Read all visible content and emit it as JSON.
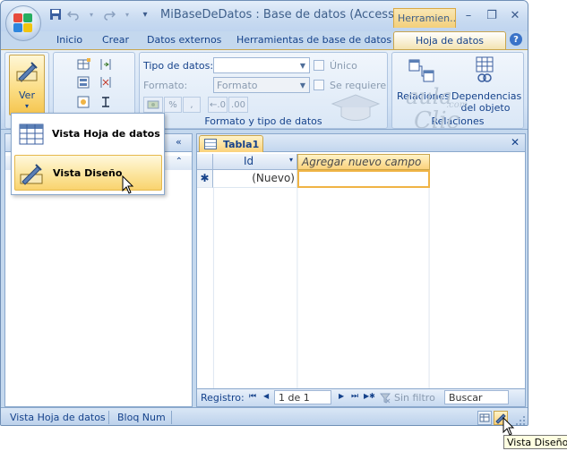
{
  "window": {
    "title": "MiBaseDeDatos : Base de datos (Access...",
    "context_tab": "Herramien...",
    "minimize": "–",
    "restore": "❐",
    "close": "✕"
  },
  "tabs": [
    "Inicio",
    "Crear",
    "Datos externos",
    "Herramientas de base de datos",
    "Hoja de datos"
  ],
  "help": "?",
  "ribbon": {
    "ver_label": "Ver",
    "ver_arrow": "▾",
    "tipo_datos_label": "Tipo de datos:",
    "formato_label": "Formato:",
    "formato_value": "Formato",
    "unico_label": "Único",
    "requiere_label": "Se requiere",
    "fmt_buttons": [
      "%",
      ",",
      "←.0",
      ".00"
    ],
    "group_formato": "Formato y tipo de datos",
    "relaciones_label": "Relaciones",
    "dependencias_label": "Dependencias del objeto",
    "group_relaciones": "Relaciones"
  },
  "menu": {
    "items": [
      {
        "label": "Vista Hoja de datos"
      },
      {
        "label": "Vista Diseño"
      }
    ]
  },
  "nav_pane": {
    "collapse": "«",
    "sub_arrow": "⌃"
  },
  "document": {
    "tab_label": "Tabla1",
    "close": "✕",
    "columns": [
      "Id",
      "Agregar nuevo campo"
    ],
    "row_marker": "✱",
    "row_values": [
      "(Nuevo)",
      ""
    ],
    "dropdown_arrow": "▾"
  },
  "record_bar": {
    "label": "Registro:",
    "first": "⏮",
    "prev": "◀",
    "position": "1 de 1",
    "next": "▶",
    "last": "⏭",
    "new": "▶✱",
    "filter": "Sin filtro",
    "search": "Buscar"
  },
  "status_bar": {
    "view": "Vista Hoja de datos",
    "numlock": "Bloq Num"
  },
  "tooltip": "Vista Diseño",
  "watermark": {
    "line1": "aula",
    "line2": "Clic",
    "line3": ".com"
  }
}
